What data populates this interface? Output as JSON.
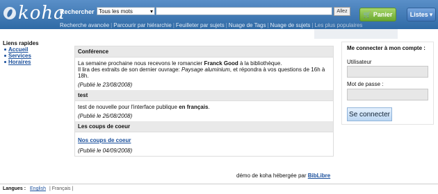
{
  "header": {
    "logo_text": "koha",
    "search_label": "Rechercher",
    "search_select_value": "Tous les mots",
    "search_input_value": "",
    "search_button": "Allez",
    "cart_button": "Panier",
    "lists_button": "Listes"
  },
  "nav": {
    "items": [
      "Recherche avancée",
      "Parcourir par hiérarchie",
      "Feuilleter par sujets",
      "Nuage de Tags",
      "Nuage de sujets",
      "Les plus populaires"
    ]
  },
  "quicklinks": {
    "title": "Liens rapides",
    "items": [
      "Accueil",
      "Services",
      "Horaires"
    ]
  },
  "news": [
    {
      "title": "Conférence",
      "line1_pre": "La semaine prochaine nous recevons le romancier ",
      "line1_bold": "Franck Good",
      "line1_post": " à la bibliothèque.",
      "line2_pre": "Il lira des extraits de son dernier ouvrage: ",
      "line2_italic": "Paysage aluminium",
      "line2_post": ", et répondra à vos questions de 16h à 18h.",
      "published": "(Publié le 23/08/2008)"
    },
    {
      "title": "test",
      "line1_pre": "test de nouvelle pour l'interface publique ",
      "line1_bold": "en français",
      "line1_post": ".",
      "published": "(Publié le 26/08/2008)"
    },
    {
      "title": "Les coups de coeur",
      "link": "Nos coups de coeur",
      "published": "(Publié le 04/09/2008)"
    }
  ],
  "login": {
    "title": "Me connecter à mon compte :",
    "user_label": "Utilisateur",
    "user_value": "",
    "password_label": "Mot de passe :",
    "password_value": "",
    "submit": "Se connecter"
  },
  "footer": {
    "hosted_text": "démo de koha hébergée par ",
    "hosted_link": "BibLibre",
    "languages_label": "Langues :",
    "lang_english": "English",
    "lang_french": "| Français |"
  }
}
